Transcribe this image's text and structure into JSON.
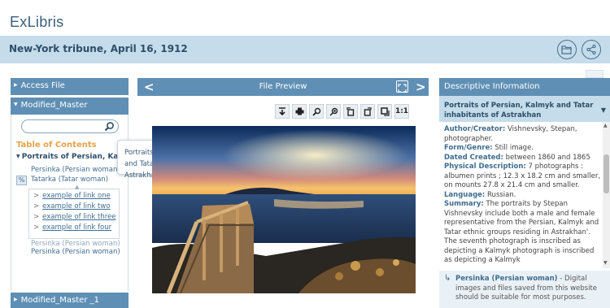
{
  "logo": {
    "text": "ExLibris"
  },
  "header": {
    "title": "New-York tribune, April 16, 1912"
  },
  "left_panel": {
    "access_file": "Access File",
    "modified_master": "Modified_Master",
    "modified_master_2": "Modified_Master _1",
    "toc_title": "Table of Contents",
    "toc_current": "Portraits of Persian, Ka...",
    "toc_items": [
      "Persinka (Persian woman)",
      "Tatarka (Tatar woman)",
      "Persinka (Persian woman)",
      "Persinka (Persian woman)"
    ],
    "links": [
      "example of link one",
      "example of link two",
      "example of link three",
      "example of link four"
    ]
  },
  "tooltip": {
    "text": "Portraits of Persian, Kalmyk and Tatar inhabitants of Astrakhan"
  },
  "center": {
    "title": "File Preview",
    "toolbar_ratio": "1:1"
  },
  "right_panel": {
    "title": "Descriptive Information",
    "record_title": "Portraits of Persian, Kalmyk and Tatar inhabitants of Astrakhan",
    "author_label": "Author/Creator:",
    "author_value": "Vishnevsky, Stepan, photographer.",
    "genre_label": "Form/Genre:",
    "genre_value": "Still image.",
    "date_label": "Dated Created:",
    "date_value": "between 1860 and 1865",
    "physical_label": "Physical Description:",
    "physical_value": "7 photographs : albumen prints ; 12.3 x 18.2 cm and smaller, on mounts 27.8 x 21.4 cm and smaller.",
    "language_label": "Language:",
    "language_value": "Russian.",
    "summary_label": "Summary:",
    "summary_value": "The portraits by Stepan Vishnevsky include both a male and female representative from the Persian, Kalmyk and Tatar ethnic groups  residing in Astrakhan'. The seventh photograph is  inscribed as depicting a Kalmyk photograph is  inscribed as depicting a Kalmyk",
    "related_title": "Persinka (Persian woman)",
    "related_text": " - Digital images and files saved from this website should be suitable for most purposes."
  }
}
